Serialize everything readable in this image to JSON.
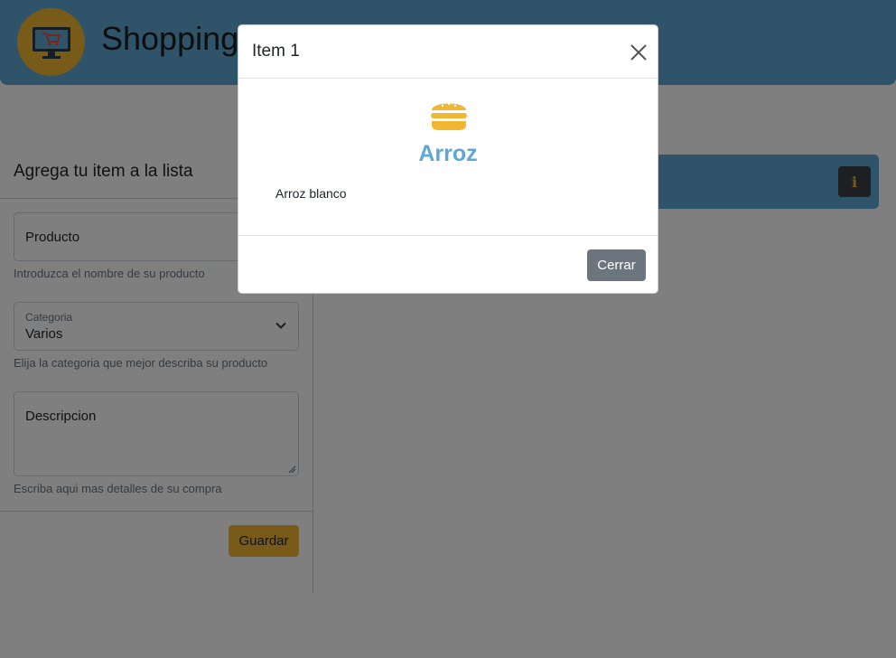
{
  "header": {
    "title": "Shopping",
    "logo_icon": "monitor-cart-icon"
  },
  "form": {
    "title": "Agrega tu item a la lista",
    "product_placeholder": "Producto",
    "product_help": "Introduzca el nombre de su producto",
    "category_label": "Categoria",
    "category_value": "Varios",
    "category_help": "Elija la categoria que mejor describa su producto",
    "description_placeholder": "Descripcion",
    "description_help": "Escriba aqui mas detalles de su compra",
    "save_label": "Guardar"
  },
  "list": {
    "info_icon": "info-icon",
    "info_label": "i"
  },
  "modal": {
    "title": "Item 1",
    "icon": "burger-icon",
    "item_name": "Arroz",
    "item_description": "Arroz blanco",
    "close_label": "Cerrar"
  },
  "colors": {
    "primary": "#5fa8d3",
    "accent": "#f2b632",
    "secondary": "#6c757d",
    "dark": "#3a3f44"
  }
}
